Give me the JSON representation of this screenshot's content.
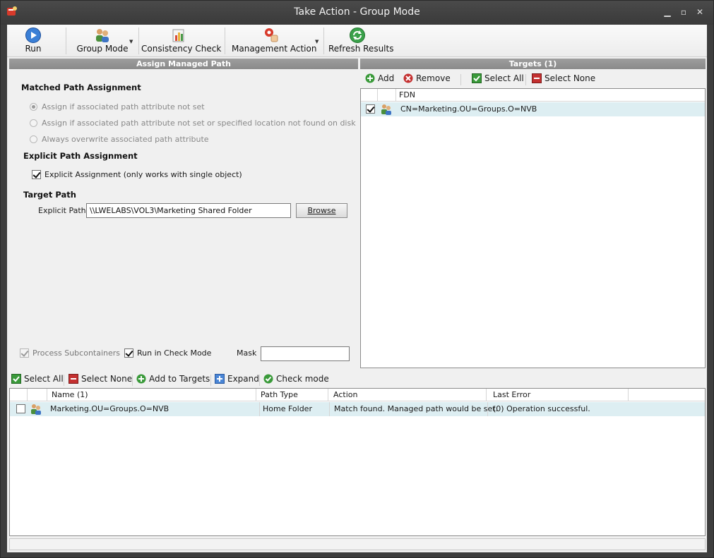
{
  "window": {
    "title": "Take Action - Group Mode"
  },
  "toolbar": {
    "run": "Run",
    "group_mode": "Group Mode",
    "consistency_check": "Consistency Check",
    "management_action": "Management Action",
    "refresh_results": "Refresh Results"
  },
  "left": {
    "header": "Assign Managed Path",
    "matched_title": "Matched Path Assignment",
    "radio1": "Assign if associated path attribute not set",
    "radio2": "Assign if associated path attribute not set or specified location not found on disk",
    "radio3": "Always overwrite associated path attribute",
    "explicit_title": "Explicit Path Assignment",
    "explicit_check": "Explicit Assignment (only works with single object)",
    "target_title": "Target Path",
    "explicit_path_label": "Explicit Path",
    "explicit_path_value": "\\\\LWELABS\\VOL3\\Marketing Shared Folder",
    "browse": "Browse",
    "process_subcontainers": "Process Subcontainers",
    "run_in_check_mode": "Run in Check Mode",
    "mask_label": "Mask",
    "mask_value": ""
  },
  "right": {
    "header": "Targets  (1)",
    "add": "Add",
    "remove": "Remove",
    "select_all": "Select All",
    "select_none": "Select None",
    "col_fdn": "FDN",
    "rows": [
      {
        "fdn": "CN=Marketing.OU=Groups.O=NVB",
        "checked": true
      }
    ]
  },
  "bottom": {
    "select_all": "Select All",
    "select_none": "Select None",
    "add_to_targets": "Add to Targets",
    "expand": "Expand",
    "check_mode": "Check mode",
    "col_name": "Name  (1)",
    "col_path_type": "Path Type",
    "col_action": "Action",
    "col_last_error": "Last Error",
    "rows": [
      {
        "name": "Marketing.OU=Groups.O=NVB",
        "path_type": "Home Folder",
        "action": "Match found. Managed path would be set.",
        "last_error": "(0) Operation successful."
      }
    ]
  },
  "colors": {
    "accent_green": "#3a9a3a",
    "accent_red": "#c43030",
    "row_highlight": "#ddeef2",
    "header_gray": "#939393"
  }
}
